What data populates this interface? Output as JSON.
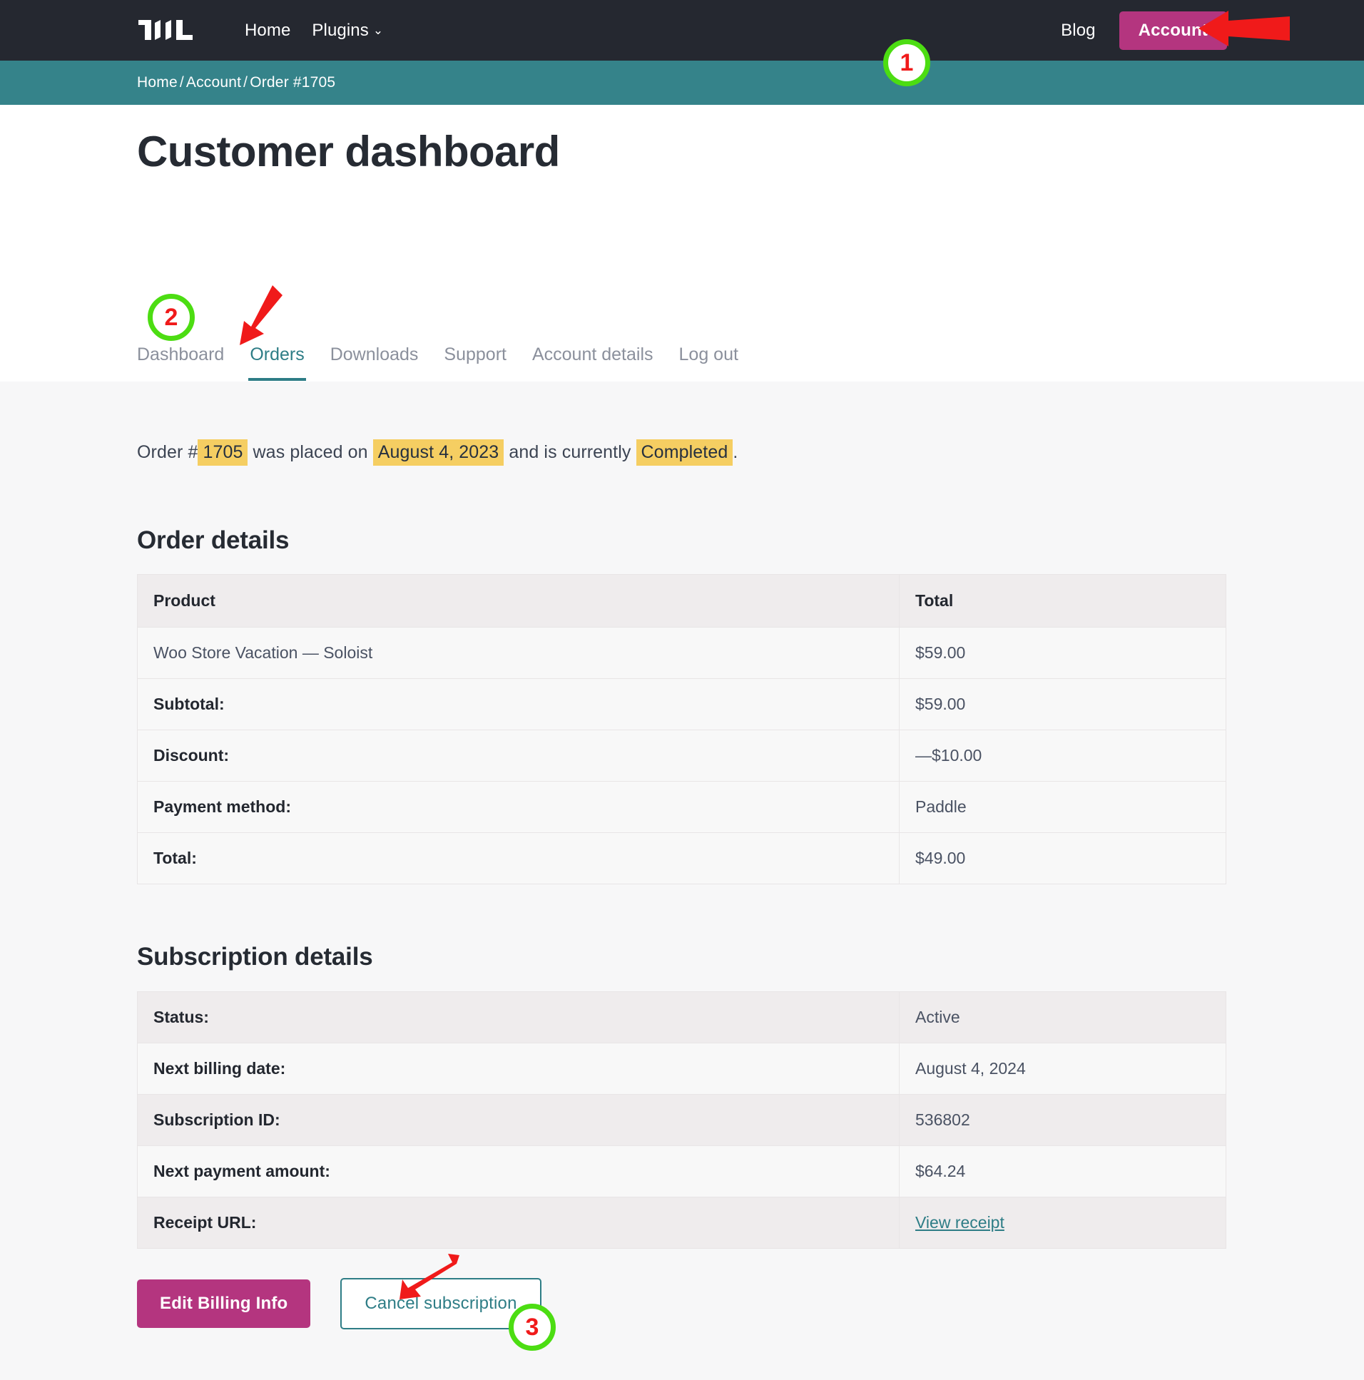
{
  "nav": {
    "logo_name": "wl-logo",
    "links": [
      {
        "label": "Home"
      },
      {
        "label": "Plugins",
        "caret": "⌄"
      }
    ],
    "blog_label": "Blog",
    "account_label": "Account"
  },
  "breadcrumb": {
    "items": [
      "Home",
      "Account",
      "Order #1705"
    ],
    "separator": "/"
  },
  "header": {
    "page_title": "Customer dashboard"
  },
  "tabs": [
    {
      "label": "Dashboard",
      "active": false
    },
    {
      "label": "Orders",
      "active": true
    },
    {
      "label": "Downloads",
      "active": false
    },
    {
      "label": "Support",
      "active": false
    },
    {
      "label": "Account details",
      "active": false
    },
    {
      "label": "Log out",
      "active": false
    }
  ],
  "order_status": {
    "prefix": "Order #",
    "order_number": "1705",
    "middle": "was placed on",
    "date": "August 4, 2023",
    "middle2": "and is currently",
    "status": "Completed",
    "suffix": "."
  },
  "order_details": {
    "title": "Order details",
    "columns": [
      "Product",
      "Total"
    ],
    "rows": [
      {
        "label": "Woo Store Vacation — Soloist",
        "value": "$59.00",
        "label_bold": false,
        "label_link": true
      },
      {
        "label": "Subtotal:",
        "value": "$59.00",
        "label_bold": true,
        "label_link": false
      },
      {
        "label": "Discount:",
        "value": "—$10.00",
        "label_bold": true,
        "label_link": false
      },
      {
        "label": "Payment method:",
        "value": "Paddle",
        "label_bold": true,
        "label_link": false
      },
      {
        "label": "Total:",
        "value": "$49.00",
        "label_bold": true,
        "label_link": false
      }
    ]
  },
  "subscription_details": {
    "title": "Subscription details",
    "rows": [
      {
        "label": "Status:",
        "value": "Active",
        "is_link": false
      },
      {
        "label": "Next billing date:",
        "value": "August 4, 2024",
        "is_link": false
      },
      {
        "label": "Subscription ID:",
        "value": "536802",
        "is_link": false
      },
      {
        "label": "Next payment amount:",
        "value": "$64.24",
        "is_link": false
      },
      {
        "label": "Receipt URL:",
        "value": "View receipt",
        "is_link": true
      }
    ]
  },
  "actions": {
    "edit_billing_label": "Edit Billing Info",
    "cancel_subscription_label": "Cancel subscription"
  },
  "annotations": [
    {
      "number": "1",
      "target": "account-button"
    },
    {
      "number": "2",
      "target": "tab-orders"
    },
    {
      "number": "3",
      "target": "cancel-subscription-button"
    }
  ],
  "colors": {
    "nav_bg": "#252830",
    "breadcrumb_bg": "#35838a",
    "accent_pink": "#b4357f",
    "accent_teal": "#2e7d86",
    "highlight_yellow": "#f5ce62",
    "content_bg": "#f7f7f8",
    "annotation_red": "#f01a1a",
    "annotation_green": "#4cdd12"
  }
}
